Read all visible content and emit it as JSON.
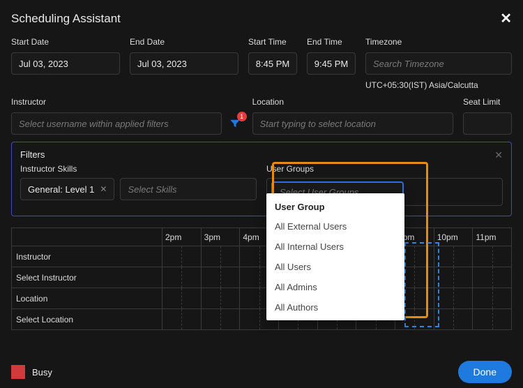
{
  "title": "Scheduling Assistant",
  "labels": {
    "startDate": "Start Date",
    "endDate": "End Date",
    "startTime": "Start Time",
    "endTime": "End Time",
    "timezone": "Timezone",
    "instructor": "Instructor",
    "location": "Location",
    "seatLimit": "Seat Limit",
    "filters": "Filters",
    "instructorSkills": "Instructor Skills",
    "userGroups": "User Groups"
  },
  "values": {
    "startDate": "Jul 03, 2023",
    "endDate": "Jul 03, 2023",
    "startTime": "8:45 PM",
    "endTime": "9:45 PM",
    "timezonePlaceholder": "Search Timezone",
    "timezoneHint": "UTC+05:30(IST) Asia/Calcutta",
    "instructorPlaceholder": "Select username within applied filters",
    "locationPlaceholder": "Start typing to select location",
    "seatLimit": "",
    "skillChip": "General: Level 1",
    "skillsPlaceholder": "Select Skills",
    "userGroupsPlaceholder": "Select User Groups",
    "filterBadge": "1"
  },
  "dropdown": {
    "header": "User Group",
    "items": [
      "All External Users",
      "All Internal Users",
      "All Users",
      "All Admins",
      "All Authors"
    ]
  },
  "grid": {
    "hours": [
      "2pm",
      "3pm",
      "4pm",
      "",
      "",
      "",
      "9pm",
      "10pm",
      "11pm"
    ],
    "rows": [
      "Instructor",
      "Select Instructor",
      "Location",
      "Select Location"
    ]
  },
  "footer": {
    "busy": "Busy",
    "done": "Done"
  }
}
